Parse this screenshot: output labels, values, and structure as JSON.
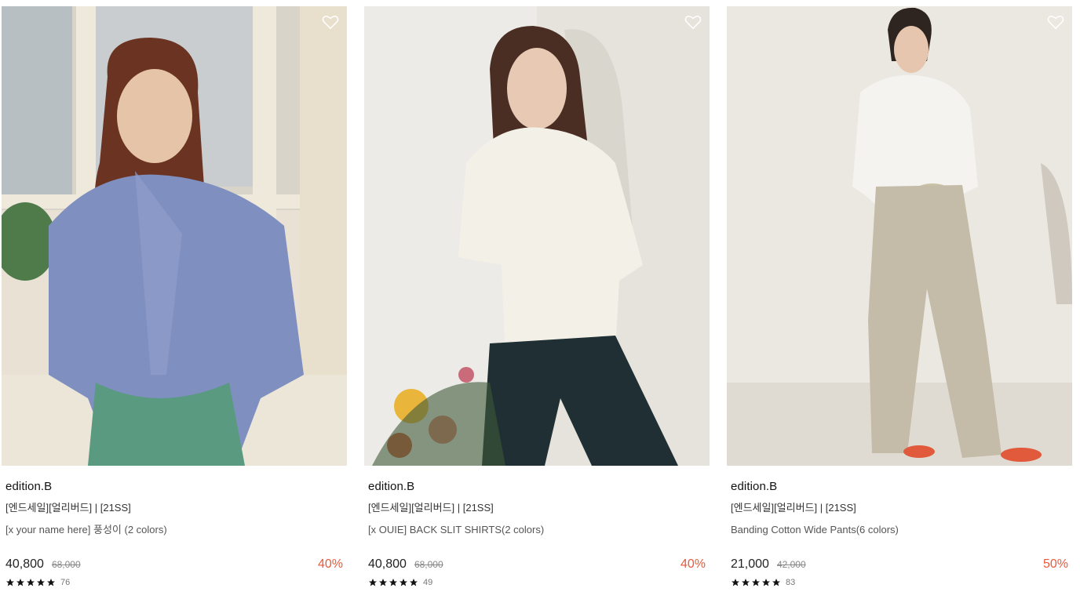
{
  "products": [
    {
      "brand": "edition.B",
      "category": "[엔드세일][얼리버드] | [21SS]",
      "title": "[x your name here] 풍성이 (2 colors)",
      "price": "40,800",
      "original_price": "68,000",
      "discount": "40%",
      "rating_stars": 5,
      "review_count": "76"
    },
    {
      "brand": "edition.B",
      "category": "[엔드세일][얼리버드] | [21SS]",
      "title": "[x OUIE] BACK SLIT SHIRTS(2 colors)",
      "price": "40,800",
      "original_price": "68,000",
      "discount": "40%",
      "rating_stars": 5,
      "review_count": "49"
    },
    {
      "brand": "edition.B",
      "category": "[엔드세일][얼리버드] | [21SS]",
      "title": "Banding Cotton Wide Pants(6 colors)",
      "price": "21,000",
      "original_price": "42,000",
      "discount": "50%",
      "rating_stars": 5,
      "review_count": "83"
    }
  ],
  "icons": {
    "wishlist": "heart-outline-icon",
    "rating": "star-icon"
  },
  "colors": {
    "discount": "#e85a3c",
    "star": "#111111"
  }
}
